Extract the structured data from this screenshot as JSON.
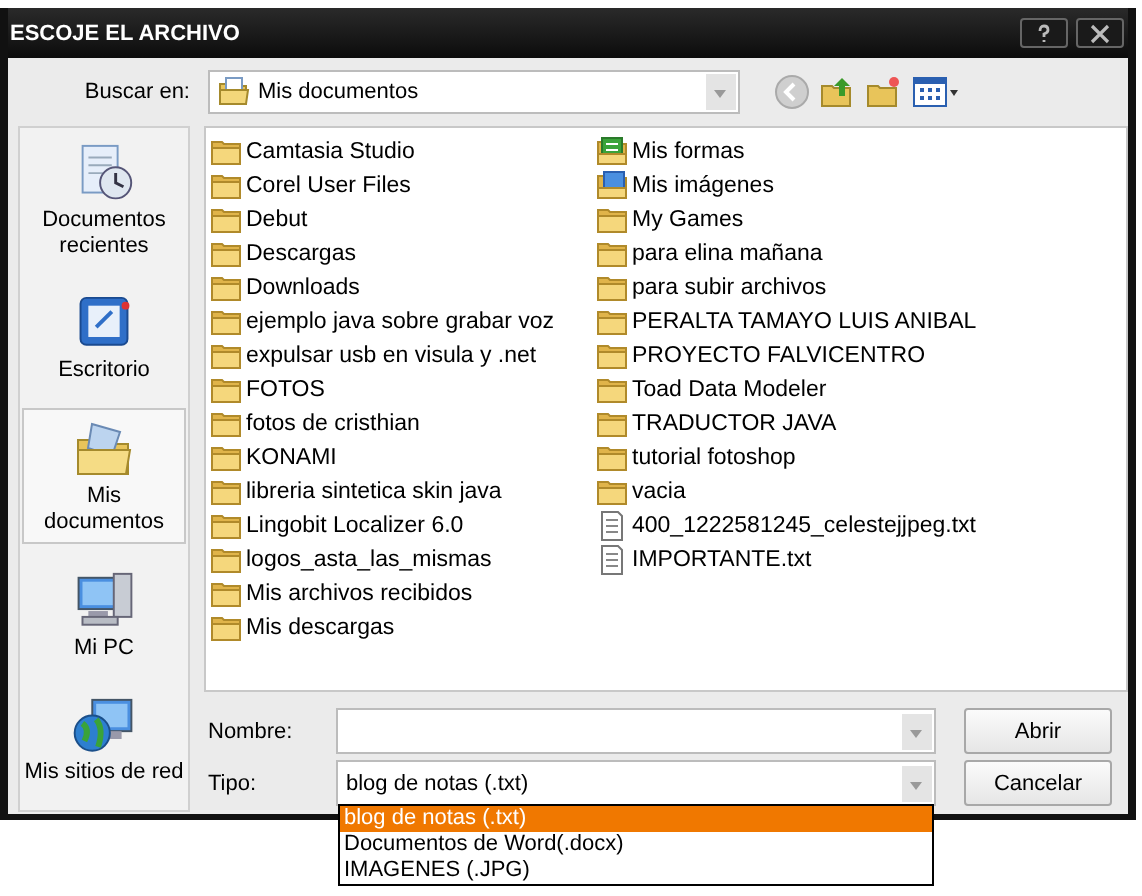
{
  "window": {
    "title": "ESCOJE EL ARCHIVO"
  },
  "look_in": {
    "label": "Buscar en:",
    "value": "Mis documentos"
  },
  "places": [
    {
      "label": "Documentos recientes",
      "kind": "recent",
      "selected": false
    },
    {
      "label": "Escritorio",
      "kind": "desktop",
      "selected": false
    },
    {
      "label": "Mis documentos",
      "kind": "documents",
      "selected": true
    },
    {
      "label": "Mi PC",
      "kind": "computer",
      "selected": false
    },
    {
      "label": "Mis sitios de red",
      "kind": "network",
      "selected": false
    }
  ],
  "files": [
    {
      "name": "Camtasia Studio",
      "kind": "folder"
    },
    {
      "name": "Corel User Files",
      "kind": "folder"
    },
    {
      "name": "Debut",
      "kind": "folder"
    },
    {
      "name": "Descargas",
      "kind": "folder"
    },
    {
      "name": "Downloads",
      "kind": "folder"
    },
    {
      "name": "ejemplo java sobre grabar voz",
      "kind": "folder"
    },
    {
      "name": "expulsar usb en visula y .net",
      "kind": "folder"
    },
    {
      "name": "FOTOS",
      "kind": "folder"
    },
    {
      "name": "fotos de cristhian",
      "kind": "folder"
    },
    {
      "name": "KONAMI",
      "kind": "folder"
    },
    {
      "name": "libreria sintetica skin java",
      "kind": "folder"
    },
    {
      "name": "Lingobit Localizer 6.0",
      "kind": "folder"
    },
    {
      "name": "logos_asta_las_mismas",
      "kind": "folder"
    },
    {
      "name": "Mis archivos recibidos",
      "kind": "folder"
    },
    {
      "name": "Mis descargas",
      "kind": "folder"
    },
    {
      "name": "Mis formas",
      "kind": "forms"
    },
    {
      "name": "Mis imágenes",
      "kind": "images"
    },
    {
      "name": "My Games",
      "kind": "folder"
    },
    {
      "name": "para elina mañana",
      "kind": "folder"
    },
    {
      "name": "para subir archivos",
      "kind": "folder"
    },
    {
      "name": "PERALTA TAMAYO LUIS ANIBAL",
      "kind": "folder"
    },
    {
      "name": "PROYECTO FALVICENTRO",
      "kind": "folder"
    },
    {
      "name": "Toad Data Modeler",
      "kind": "folder"
    },
    {
      "name": "TRADUCTOR JAVA",
      "kind": "folder"
    },
    {
      "name": "tutorial fotoshop",
      "kind": "folder"
    },
    {
      "name": "vacia",
      "kind": "folder"
    },
    {
      "name": "400_1222581245_celestejjpeg.txt",
      "kind": "text"
    },
    {
      "name": "IMPORTANTE.txt",
      "kind": "text"
    }
  ],
  "file_name": {
    "label": "Nombre:"
  },
  "file_type": {
    "label": "Tipo:",
    "value": "blog de notas (.txt)",
    "expanded": true,
    "options": [
      {
        "label": "blog de notas (.txt)",
        "selected": true
      },
      {
        "label": "Documentos de Word(.docx)",
        "selected": false
      },
      {
        "label": "IMAGENES (.JPG)",
        "selected": false
      }
    ]
  },
  "buttons": [
    "Abrir",
    "Cancelar"
  ]
}
